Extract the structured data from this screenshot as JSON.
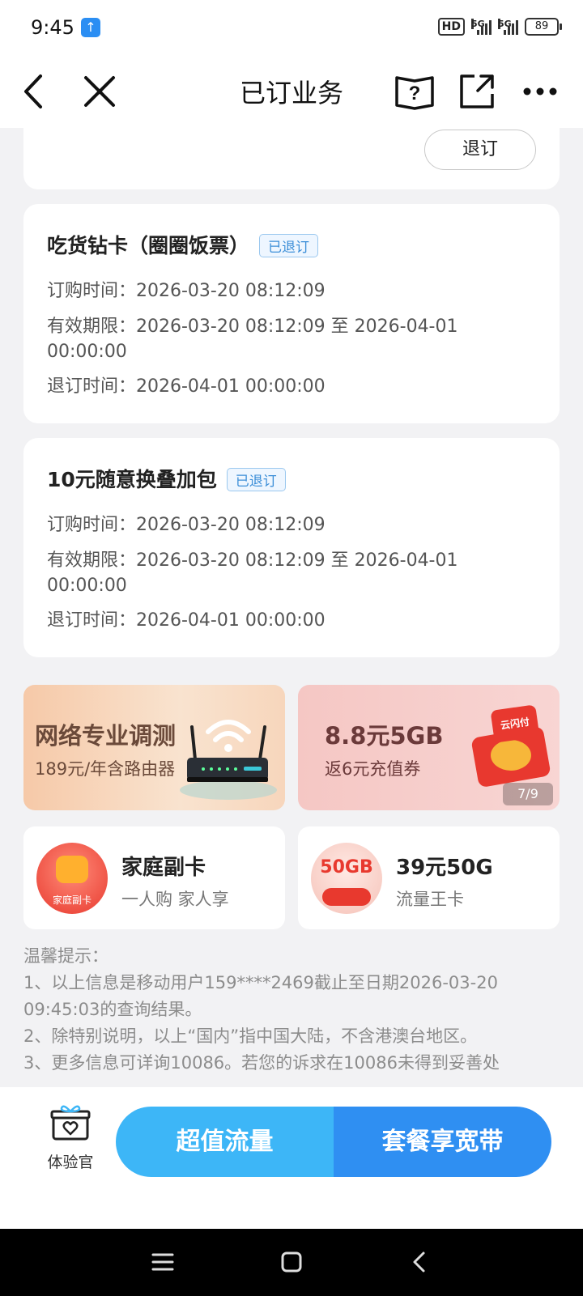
{
  "status_bar": {
    "time": "9:45",
    "network_hd": "HD",
    "signal1": "5G",
    "signal2": "5G",
    "battery": "89"
  },
  "nav": {
    "title": "已订业务"
  },
  "top_card": {
    "unsubscribe_label": "退订"
  },
  "subscriptions": [
    {
      "name": "吃货钻卡（圈圈饭票）",
      "status": "已退订",
      "order_time": "订购时间：2026-03-20 08:12:09",
      "validity": "有效期限：2026-03-20 08:12:09 至 2026-04-01 00:00:00",
      "unsubscribe_time": "退订时间：2026-04-01 00:00:00"
    },
    {
      "name": "10元随意换叠加包",
      "status": "已退订",
      "order_time": "订购时间：2026-03-20 08:12:09",
      "validity": "有效期限：2026-03-20 08:12:09 至 2026-04-01 00:00:00",
      "unsubscribe_time": "退订时间：2026-04-01 00:00:00"
    }
  ],
  "promos": [
    {
      "title": "网络专业调测",
      "subtitle": "189元/年含路由器"
    },
    {
      "title": "8.8元5GB",
      "subtitle": "返6元充值券",
      "pager": "7/9",
      "badge_text": "云闪付"
    }
  ],
  "mini_cards": [
    {
      "title": "家庭副卡",
      "subtitle": "一人购 家人享",
      "icon_text": "家庭副卡"
    },
    {
      "title": "39元50G",
      "subtitle": "流量王卡",
      "icon_text": "50GB"
    }
  ],
  "tips": {
    "heading": "温馨提示：",
    "lines": [
      "1、以上信息是移动用户159****2469截止至日期2026-03-20 09:45:03的查询结果。",
      "2、除特别说明，以上“国内”指中国大陆，不含港澳台地区。",
      "3、更多信息可详询10086。若您的诉求在10086未得到妥善处"
    ]
  },
  "bottom_bar": {
    "experience_label": "体验官",
    "cta_left": "超值流量",
    "cta_right": "套餐享宽带"
  },
  "colors": {
    "accent_blue": "#2f8ff2",
    "light_blue": "#3db6f7",
    "tag_blue": "#3d8fd8",
    "bg": "#f2f2f4"
  }
}
